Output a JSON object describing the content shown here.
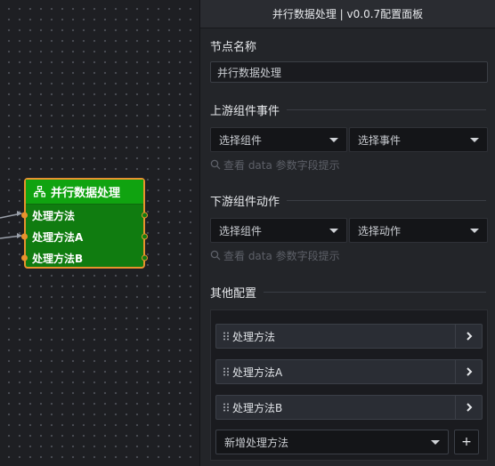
{
  "node": {
    "title": "并行数据处理",
    "icon": "flow-hierarchy-icon",
    "rows": [
      "处理方法",
      "处理方法A",
      "处理方法B"
    ],
    "colors": {
      "header": "#10a310",
      "body": "#107c10",
      "border": "#e8922e"
    }
  },
  "panel": {
    "title": "并行数据处理 | v0.0.7配置面板",
    "node_name_label": "节点名称",
    "node_name_value": "并行数据处理",
    "upstream": {
      "label": "上游组件事件",
      "component_select": "选择组件",
      "event_select": "选择事件",
      "hint": "查看 data 参数字段提示"
    },
    "downstream": {
      "label": "下游组件动作",
      "component_select": "选择组件",
      "action_select": "选择动作",
      "hint": "查看 data 参数字段提示"
    },
    "other": {
      "label": "其他配置",
      "methods": [
        "处理方法",
        "处理方法A",
        "处理方法B"
      ],
      "add_select": "新增处理方法",
      "add_button": "+"
    }
  }
}
